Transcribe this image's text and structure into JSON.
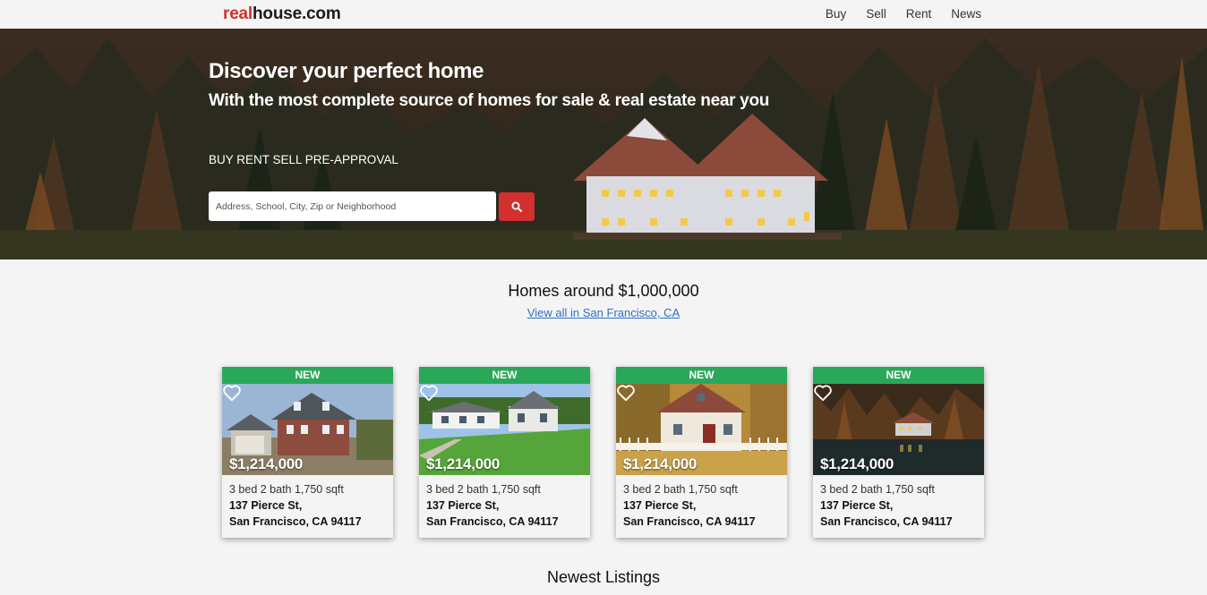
{
  "brand": {
    "prefix": "real",
    "suffix": "house.com"
  },
  "nav": [
    {
      "label": "Buy"
    },
    {
      "label": "Sell"
    },
    {
      "label": "Rent"
    },
    {
      "label": "News"
    }
  ],
  "hero": {
    "title": "Discover your perfect home",
    "subtitle": "With the most complete source of homes for sale & real estate near you",
    "modes": "BUY RENT SELL PRE-APPROVAL",
    "search_placeholder": "Address, School, City, Zip or Neighborhood",
    "search_icon": "search-icon"
  },
  "featured": {
    "title": "Homes around $1,000,000",
    "link": "View all in San Francisco, CA"
  },
  "listings": [
    {
      "badge": "NEW",
      "price": "$1,214,000",
      "specs": "3 bed 2 bath 1,750 sqft",
      "street": "137 Pierce St,",
      "city": "San Francisco, CA 94117",
      "icon": "heart-icon"
    },
    {
      "badge": "NEW",
      "price": "$1,214,000",
      "specs": "3 bed 2 bath 1,750 sqft",
      "street": "137 Pierce St,",
      "city": "San Francisco, CA 94117",
      "icon": "heart-icon"
    },
    {
      "badge": "NEW",
      "price": "$1,214,000",
      "specs": "3 bed 2 bath 1,750 sqft",
      "street": "137 Pierce St,",
      "city": "San Francisco, CA 94117",
      "icon": "heart-icon"
    },
    {
      "badge": "NEW",
      "price": "$1,214,000",
      "specs": "3 bed 2 bath 1,750 sqft",
      "street": "137 Pierce St,",
      "city": "San Francisco, CA 94117",
      "icon": "heart-icon"
    }
  ],
  "newest": {
    "title": "Newest Listings"
  },
  "colors": {
    "brand_red": "#d32f2f",
    "badge_green": "#2aa85a",
    "link_blue": "#2f6fc4",
    "page_bg": "#f4f4f4"
  }
}
